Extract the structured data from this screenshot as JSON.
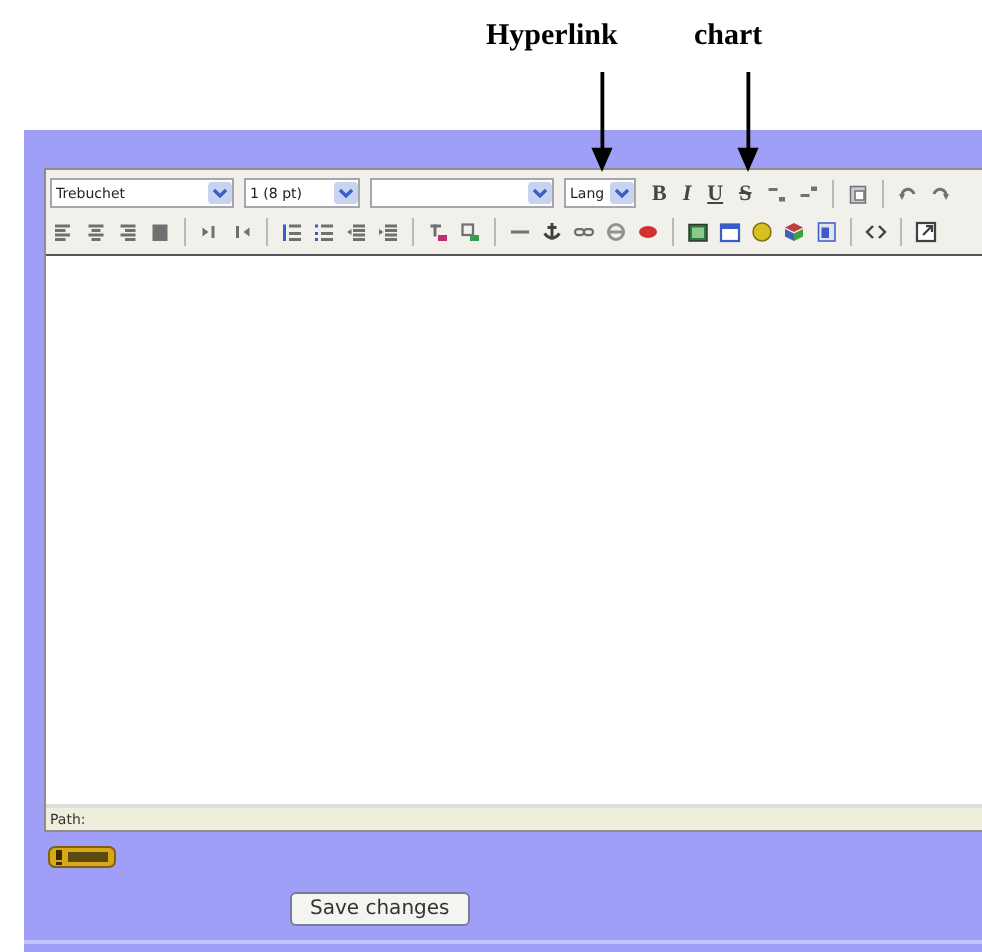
{
  "annotations": [
    {
      "label": "Hyperlink"
    },
    {
      "label": "chart"
    }
  ],
  "toolbar": {
    "selects": [
      {
        "value": "Trebuchet",
        "kind": "wide"
      },
      {
        "value": "1 (8 pt)",
        "kind": "narrow"
      },
      {
        "kind": "wide"
      },
      {
        "value": "Lang",
        "kind": "small"
      }
    ],
    "format_buttons": [
      {
        "label": "B",
        "kind": "bold"
      },
      {
        "label": "I",
        "kind": "italic"
      },
      {
        "label": "U",
        "kind": "underline"
      },
      {
        "label": "S",
        "kind": "strike"
      }
    ]
  },
  "status_bar": {
    "label": "Path:"
  },
  "buttons": [
    {
      "label": "Save changes"
    }
  ]
}
